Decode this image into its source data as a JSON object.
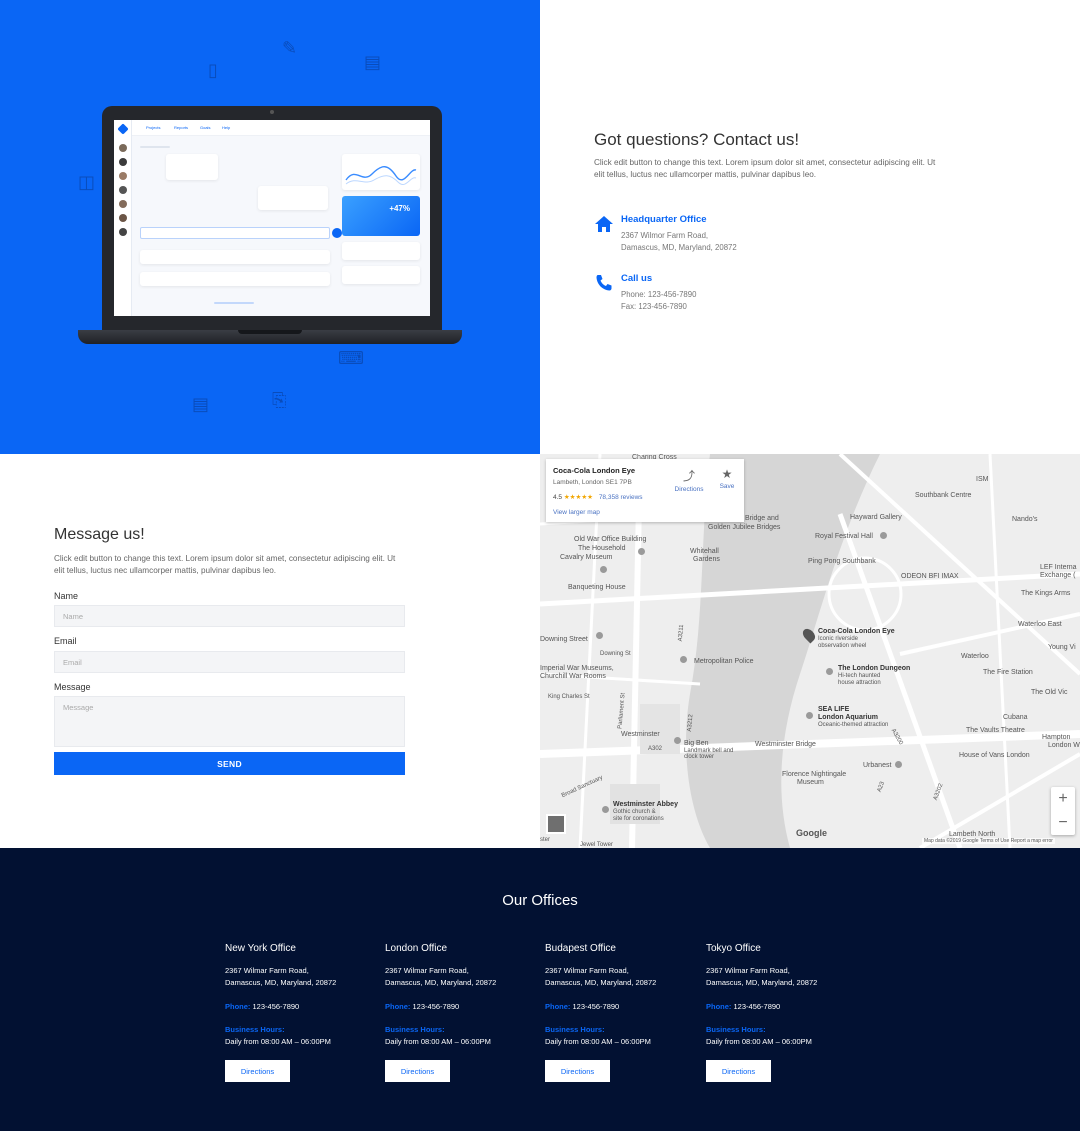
{
  "hero": {
    "app": {
      "tabs": [
        "Projects",
        "Reports",
        "Goals",
        "Help"
      ],
      "stat_value": "+47%"
    }
  },
  "contact": {
    "title": "Got questions? Contact us!",
    "lead": "Click edit button to change this text. Lorem ipsum dolor sit amet, consectetur adipiscing elit. Ut elit tellus, luctus nec ullamcorper mattis, pulvinar dapibus leo.",
    "hq": {
      "title": "Headquarter Office",
      "line1": "2367 Wilmor Farm Road,",
      "line2": "Damascus, MD, Maryland, 20872",
      "icon": "home-icon"
    },
    "call": {
      "title": "Call us",
      "line1": "Phone: 123-456-7890",
      "line2": "Fax: 123-456-7890",
      "icon": "phone-icon"
    },
    "accent": "#0a66f5"
  },
  "message": {
    "title": "Message us!",
    "lead": "Click edit button to change this text. Lorem ipsum dolor sit amet, consectetur adipiscing elit. Ut elit tellus, luctus nec ullamcorper mattis, pulvinar dapibus leo.",
    "name_label": "Name",
    "name_placeholder": "Name",
    "email_label": "Email",
    "email_placeholder": "Email",
    "message_label": "Message",
    "message_placeholder": "Message",
    "send_label": "SEND"
  },
  "map": {
    "card": {
      "title": "Coca-Cola London Eye",
      "address": "Lambeth, London SE1 7PB",
      "rating": "4.5",
      "stars": "★★★★★",
      "reviews": "78,358 reviews",
      "view_larger": "View larger map",
      "directions": "Directions",
      "save": "Save"
    },
    "labels": {
      "charing_cross": "Charing Cross",
      "southbank": "Southbank Centre",
      "ism": "ISM",
      "hayward": "Hayward Gallery",
      "nandos": "Nando's",
      "golden_jubilee_1": "Hungerford Bridge and",
      "golden_jubilee_2": "Golden Jubilee Bridges",
      "royal_festival": "Royal Festival Hall",
      "old_war_1": "Old War Office Building",
      "old_war_2": "The Household",
      "old_war_3": "Cavalry Museum",
      "whitehall_1": "Whitehall",
      "whitehall_2": "Gardens",
      "ping_pong": "Ping Pong Southbank",
      "odeon": "ODEON BFI IMAX",
      "lef": "LEF Interna",
      "lef2": "Exchange (",
      "banqueting": "Banqueting House",
      "kings_arms": "The Kings Arms",
      "london_eye_1": "Coca-Cola London Eye",
      "london_eye_2": "Iconic riverside",
      "london_eye_3": "observation wheel",
      "waterloo_east": "Waterloo East",
      "downing": "Downing Street",
      "downing_st": "Downing St",
      "metro_police": "Metropolitan Police",
      "waterloo": "Waterloo",
      "young_vic": "Young Vi",
      "imperial_1": "Imperial War Museums,",
      "imperial_2": "Churchill War Rooms",
      "dungeon_1": "The London Dungeon",
      "dungeon_2": "Hi-tech haunted",
      "dungeon_3": "house attraction",
      "fire_station": "The Fire Station",
      "king_charles": "King Charles St",
      "old_vic": "The Old Vic",
      "sea_life_1": "SEA LIFE",
      "sea_life_2": "London Aquarium",
      "sea_life_3": "Oceanic-themed attraction",
      "cubana": "Cubana",
      "vaults": "The Vaults Theatre",
      "westminster": "Westminster",
      "big_ben_1": "Big Ben",
      "big_ben_2": "Landmark bell and",
      "big_ben_3": "clock tower",
      "westminster_bridge": "Westminster Bridge",
      "hampton": "Hampton",
      "london_w": "London W",
      "vans": "House of Vans London",
      "urbanest": "Urbanest",
      "nightingale_1": "Florence Nightingale",
      "nightingale_2": "Museum",
      "broad_sanctuary": "Broad Sanctuary",
      "abbey_1": "Westminster Abbey",
      "abbey_2": "Gothic church &",
      "abbey_3": "site for coronations",
      "lambeth_north": "Lambeth North",
      "parliament_st": "Parliament St",
      "a3211": "A3211",
      "a3212": "A3212",
      "a302": "A302",
      "a3200": "A3200",
      "a23": "A23",
      "a3202": "A3202",
      "jewel": "Jewel Tower",
      "ster": "ster"
    },
    "google": "Google",
    "footer": "Map data ©2019 Google    Terms of Use    Report a map error",
    "zoom_in": "+",
    "zoom_out": "−"
  },
  "offices": {
    "title": "Our Offices",
    "phone_key": "Phone:",
    "hours_key": "Business Hours:",
    "list": [
      {
        "name": "New York Office",
        "addr1": "2367 Wilmar Farm Road,",
        "addr2": "Damascus, MD, Maryland, 20872",
        "phone": "123-456-7890",
        "hours": "Daily from 08:00 AM – 06:00PM",
        "button": "Directions"
      },
      {
        "name": "London Office",
        "addr1": "2367 Wilmar Farm Road,",
        "addr2": "Damascus, MD, Maryland, 20872",
        "phone": "123-456-7890",
        "hours": "Daily from 08:00 AM – 06:00PM",
        "button": "Directions"
      },
      {
        "name": "Budapest Office",
        "addr1": "2367 Wilmar Farm Road,",
        "addr2": "Damascus, MD, Maryland, 20872",
        "phone": "123-456-7890",
        "hours": "Daily from 08:00 AM – 06:00PM",
        "button": "Directions"
      },
      {
        "name": "Tokyo Office",
        "addr1": "2367 Wilmar Farm Road,",
        "addr2": "Damascus, MD, Maryland, 20872",
        "phone": "123-456-7890",
        "hours": "Daily from 08:00 AM – 06:00PM",
        "button": "Directions"
      }
    ]
  }
}
